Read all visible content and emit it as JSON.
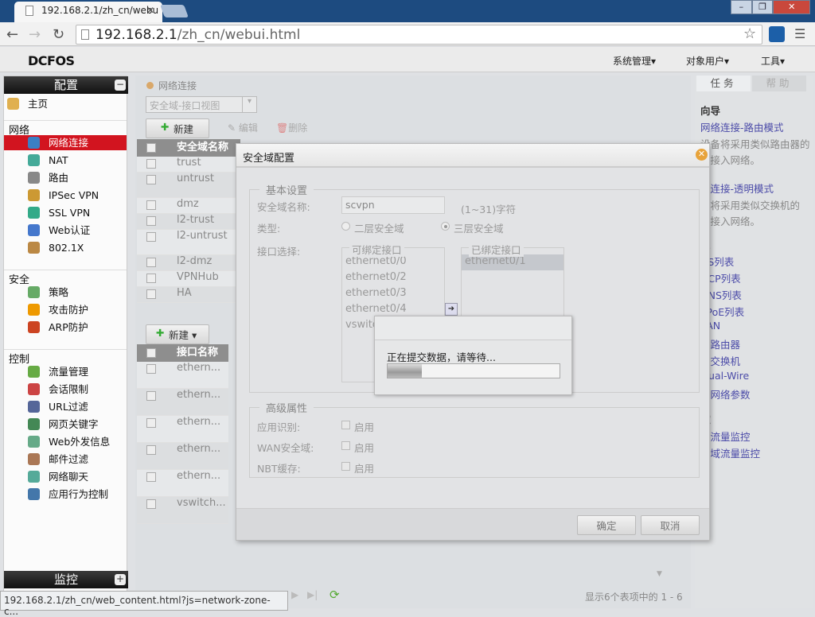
{
  "browser": {
    "tab_title": "192.168.2.1/zh_cn/webu",
    "url_host": "192.168.2.1",
    "url_path": "/zh_cn/webui.html"
  },
  "app": {
    "logo": "DCFOS",
    "menus": [
      "系统管理▾",
      "对象用户▾",
      "工具▾"
    ]
  },
  "sidebar": {
    "header": "配置",
    "footer": "监控",
    "home": "主页",
    "groups": [
      {
        "label": "网络",
        "items": [
          "网络连接",
          "NAT",
          "路由",
          "IPSec VPN",
          "SSL VPN",
          "Web认证",
          "802.1X"
        ]
      },
      {
        "label": "安全",
        "items": [
          "策略",
          "攻击防护",
          "ARP防护"
        ]
      },
      {
        "label": "控制",
        "items": [
          "流量管理",
          "会话限制",
          "URL过滤",
          "网页关键字",
          "Web外发信息",
          "邮件过滤",
          "网络聊天",
          "应用行为控制"
        ]
      }
    ],
    "active": "网络连接"
  },
  "main": {
    "breadcrumb": "网络连接",
    "view_select": "安全域-接口视图",
    "toolbar": {
      "new": "新建",
      "edit": "编辑",
      "delete": "删除"
    },
    "zone_table": {
      "header": "安全域名称",
      "rows": [
        "trust",
        "untrust",
        "dmz",
        "l2-trust",
        "l2-untrust",
        "l2-dmz",
        "VPNHub",
        "HA"
      ]
    },
    "iface_toolbar": {
      "new": "新建"
    },
    "iface_table": {
      "header": "接口名称",
      "rows": [
        "ethern...",
        "ethern...",
        "ethern...",
        "ethern...",
        "ethern...",
        "vswitch..."
      ]
    },
    "pager": {
      "page": "1",
      "summary": "显示6个表项中的 1 - 6"
    }
  },
  "right": {
    "tabs": [
      "任务",
      "帮助"
    ],
    "lines": [
      {
        "t": "h",
        "v": "向导"
      },
      {
        "t": "l",
        "v": "网络连接-路由模式"
      },
      {
        "t": "d",
        "v": "设备将采用类似路由器的"
      },
      {
        "t": "d",
        "v": "式接入网络。"
      },
      {
        "t": "l",
        "v": "络连接-透明模式"
      },
      {
        "t": "d",
        "v": "备将采用类似交换机的"
      },
      {
        "t": "d",
        "v": "式接入网络。"
      },
      {
        "t": "h",
        "v": "置"
      },
      {
        "t": "l",
        "v": "NS列表"
      },
      {
        "t": "l",
        "v": "HCP列表"
      },
      {
        "t": "l",
        "v": "DNS列表"
      },
      {
        "t": "l",
        "v": "PPoE列表"
      },
      {
        "t": "l",
        "v": "LAN"
      },
      {
        "t": "l",
        "v": "拟路由器"
      },
      {
        "t": "l",
        "v": "拟交换机"
      },
      {
        "t": "l",
        "v": "rtual-Wire"
      },
      {
        "t": "l",
        "v": "局网络参数"
      },
      {
        "t": "h",
        "v": "控"
      },
      {
        "t": "l",
        "v": "口流量监控"
      },
      {
        "t": "l",
        "v": "全域流量监控"
      }
    ]
  },
  "dialog": {
    "title": "安全域配置",
    "basic_legend": "基本设置",
    "name_label": "安全域名称:",
    "name_value": "scvpn",
    "name_hint": "(1~31)字符",
    "type_label": "类型:",
    "type_l2": "二层安全域",
    "type_l3": "三层安全域",
    "type_selected": "三层安全域",
    "iface_label": "接口选择:",
    "available_legend": "可绑定接口",
    "available": [
      "ethernet0/0",
      "ethernet0/2",
      "ethernet0/3",
      "ethernet0/4",
      "vswitc"
    ],
    "bound_legend": "已绑定接口",
    "bound": [
      "ethernet0/1"
    ],
    "adv_legend": "高级属性",
    "adv": [
      {
        "label": "应用识别:",
        "opt": "启用"
      },
      {
        "label": "WAN安全域:",
        "opt": "启用"
      },
      {
        "label": "NBT缓存:",
        "opt": "启用"
      }
    ],
    "ok": "确定",
    "cancel": "取消"
  },
  "wait": {
    "message": "正在提交数据，请等待...",
    "progress_percent": 20
  },
  "status_bar": "192.168.2.1/zh_cn/web_content.html?js=network-zone-c..."
}
